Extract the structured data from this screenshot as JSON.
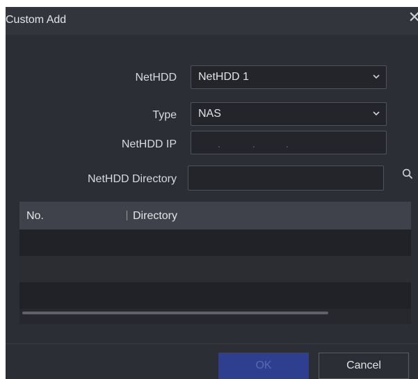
{
  "dialog": {
    "title": "Custom Add",
    "close_symbol": "✕"
  },
  "form": {
    "nethdd": {
      "label": "NetHDD",
      "value": "NetHDD 1"
    },
    "type": {
      "label": "Type",
      "value": "NAS"
    },
    "ip": {
      "label": "NetHDD IP",
      "value": "",
      "placeholder_dots": [
        ".",
        ".",
        "."
      ]
    },
    "directory": {
      "label": "NetHDD Directory",
      "value": ""
    }
  },
  "table": {
    "columns": [
      "No.",
      "Directory"
    ],
    "rows": []
  },
  "buttons": {
    "ok": "OK",
    "cancel": "Cancel"
  },
  "icons": {
    "close": "close-icon",
    "dropdown": "chevron-down-icon",
    "search": "search-icon"
  },
  "colors": {
    "background": "#2c2e35",
    "header": "#3f424a",
    "primary_button": "#2e3f8f"
  }
}
